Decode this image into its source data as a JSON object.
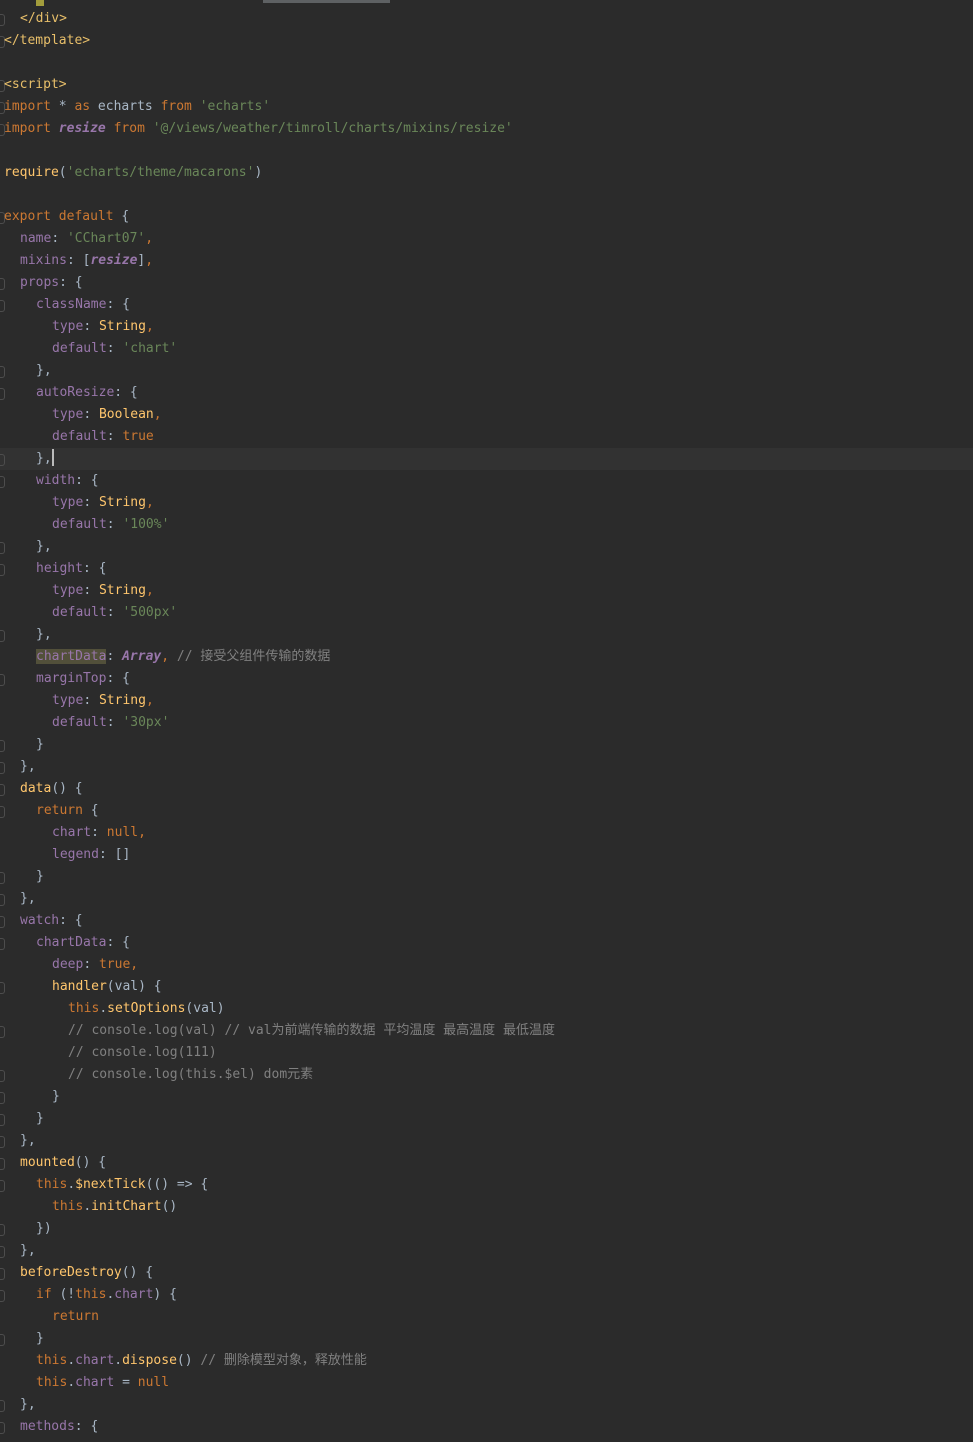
{
  "editor": {
    "language": "Vue / JavaScript",
    "top_fragment": "</",
    "lines": {
      "l1": "</div>",
      "l2": "</template>",
      "l4": "<script>",
      "l5": {
        "k1": "import",
        "a": " * ",
        "k2": "as",
        "b": " echarts ",
        "k3": "from",
        "s": " 'echarts'"
      },
      "l6": {
        "k1": "import",
        "b": " resize ",
        "k2": "from",
        "s": " '@/views/weather/timroll/charts/mixins/resize'"
      },
      "l8": {
        "fn": "require",
        "s": "'echarts/theme/macarons'"
      },
      "l10": {
        "k": "export default",
        "a": " {"
      },
      "l11": {
        "p": "name",
        "s": "'CChart07'"
      },
      "l12": {
        "p": "mixins",
        "r": "resize"
      },
      "l13": {
        "p": "props"
      },
      "l14": {
        "p": "className"
      },
      "l15": {
        "p": "type",
        "v": "String"
      },
      "l16": {
        "p": "default",
        "s": "'chart'"
      },
      "l17": "},",
      "l18": {
        "p": "autoResize"
      },
      "l19": {
        "p": "type",
        "v": "Boolean"
      },
      "l20": {
        "p": "default",
        "v": "true"
      },
      "l21": "},",
      "l22": {
        "p": "width"
      },
      "l23": {
        "p": "type",
        "v": "String"
      },
      "l24": {
        "p": "default",
        "s": "'100%'"
      },
      "l25": "},",
      "l26": {
        "p": "height"
      },
      "l27": {
        "p": "type",
        "v": "String"
      },
      "l28": {
        "p": "default",
        "s": "'500px'"
      },
      "l29": "},",
      "l30": {
        "p": "chartData",
        "v": "Array",
        "c": "// 接受父组件传输的数据"
      },
      "l31": {
        "p": "marginTop"
      },
      "l32": {
        "p": "type",
        "v": "String"
      },
      "l33": {
        "p": "default",
        "s": "'30px'"
      },
      "l34": "}",
      "l35": "},",
      "l36": {
        "fn": "data",
        "a": "() {"
      },
      "l37": {
        "k": "return",
        "a": " {"
      },
      "l38": {
        "p": "chart",
        "v": "null"
      },
      "l39": {
        "p": "legend",
        "a": ": []"
      },
      "l40": "}",
      "l41": "},",
      "l42": {
        "p": "watch"
      },
      "l43": {
        "p": "chartData"
      },
      "l44": {
        "p": "deep",
        "v": "true"
      },
      "l45": {
        "fn": "handler",
        "a": "(val) {"
      },
      "l46": {
        "k": "this",
        "fn": "setOptions",
        "a": "(val)"
      },
      "l47": {
        "c": "// console.log(val) // val为前端传输的数据 平均温度 最高温度 最低温度"
      },
      "l48": {
        "c": "// console.log(111)"
      },
      "l49": {
        "c": "// console.log(this.$el) dom元素"
      },
      "l50": "}",
      "l51": "}",
      "l52": "},",
      "l53": {
        "fn": "mounted",
        "a": "() {"
      },
      "l54": {
        "k": "this",
        "fn": "$nextTick",
        "a": "(() => {"
      },
      "l55": {
        "k": "this",
        "fn": "initChart",
        "a": "()"
      },
      "l56": "})",
      "l57": "},",
      "l58": {
        "fn": "beforeDestroy",
        "a": "() {"
      },
      "l59": {
        "k": "if",
        "a1": " (!",
        "k2": "this",
        "p": "chart",
        "a2": ") {"
      },
      "l60": {
        "k": "return"
      },
      "l61": "}",
      "l62": {
        "k": "this",
        "p": "chart",
        "fn": "dispose",
        "a": "()",
        "c": "// 删除模型对象，释放性能"
      },
      "l63": {
        "k": "this",
        "p": "chart",
        "a": " = ",
        "v": "null"
      },
      "l64": "},",
      "l65": {
        "p": "methods"
      }
    }
  },
  "colors": {
    "background": "#2b2b2b",
    "current_line": "#323232",
    "keyword": "#cc7832",
    "string": "#6a8759",
    "property": "#9876aa",
    "function": "#ffc66d",
    "comment": "#808080",
    "tag": "#e8bf6a",
    "text": "#a9b7c6"
  }
}
